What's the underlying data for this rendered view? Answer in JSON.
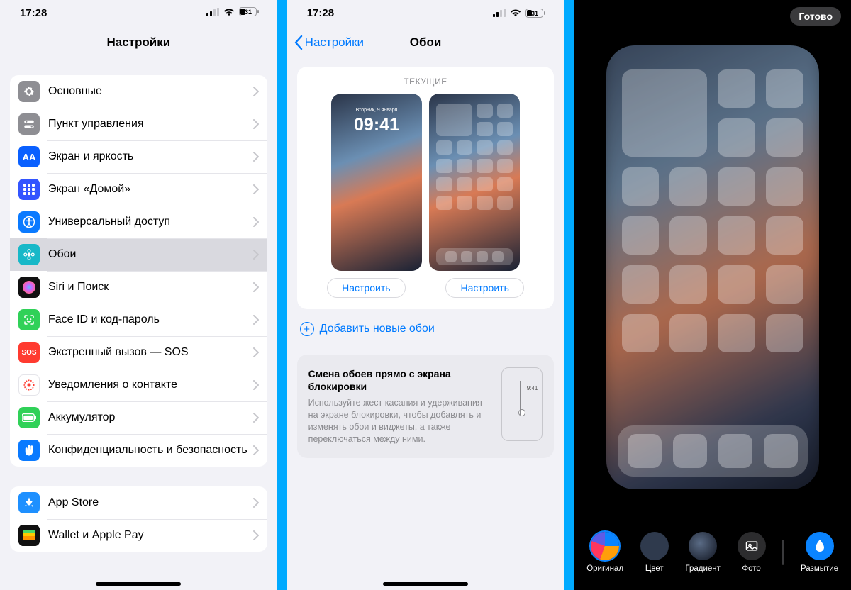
{
  "status": {
    "time": "17:28",
    "battery": "31"
  },
  "screen1": {
    "title": "Настройки",
    "group1": [
      {
        "label": "Основные",
        "color": "#8e8e93",
        "icon": "gear"
      },
      {
        "label": "Пункт управления",
        "color": "#8e8e93",
        "icon": "switches"
      },
      {
        "label": "Экран и яркость",
        "color": "#0a60ff",
        "icon": "AA"
      },
      {
        "label": "Экран «Домой»",
        "color": "#3355ff",
        "icon": "grid"
      },
      {
        "label": "Универсальный доступ",
        "color": "#0a7aff",
        "icon": "access"
      },
      {
        "label": "Обои",
        "color": "#17b8c8",
        "icon": "flower",
        "selected": true
      },
      {
        "label": "Siri и Поиск",
        "color": "#222",
        "icon": "siri"
      },
      {
        "label": "Face ID и код-пароль",
        "color": "#30d158",
        "icon": "face"
      },
      {
        "label": "Экстренный вызов — SOS",
        "color": "#ff3b30",
        "icon": "SOS"
      },
      {
        "label": "Уведомления о контакте",
        "color": "#fff",
        "icon": "contact",
        "fg": "#ff3b30",
        "border": true
      },
      {
        "label": "Аккумулятор",
        "color": "#30d158",
        "icon": "battery"
      },
      {
        "label": "Конфиденциальность и безопасность",
        "color": "#0a7aff",
        "icon": "hand"
      }
    ],
    "group2": [
      {
        "label": "App Store",
        "color": "#1e90ff",
        "icon": "appstore"
      },
      {
        "label": "Wallet и Apple Pay",
        "color": "#000",
        "icon": "wallet"
      }
    ]
  },
  "screen2": {
    "back": "Настройки",
    "title": "Обои",
    "current": "ТЕКУЩИЕ",
    "lock_date": "Вторник, 9 января",
    "lock_time": "09:41",
    "customize": "Настроить",
    "add_new": "Добавить новые обои",
    "tip_title": "Смена обоев прямо с экрана блокировки",
    "tip_body": "Используйте жест касания и удерживания на экране блокировки, чтобы добавлять и изменять обои и виджеты, а также переключаться между ними.",
    "tip_time": "9:41"
  },
  "screen3": {
    "done": "Готово",
    "options": {
      "original": "Оригинал",
      "color": "Цвет",
      "gradient": "Градиент",
      "photo": "Фото",
      "blur": "Размытие"
    }
  }
}
